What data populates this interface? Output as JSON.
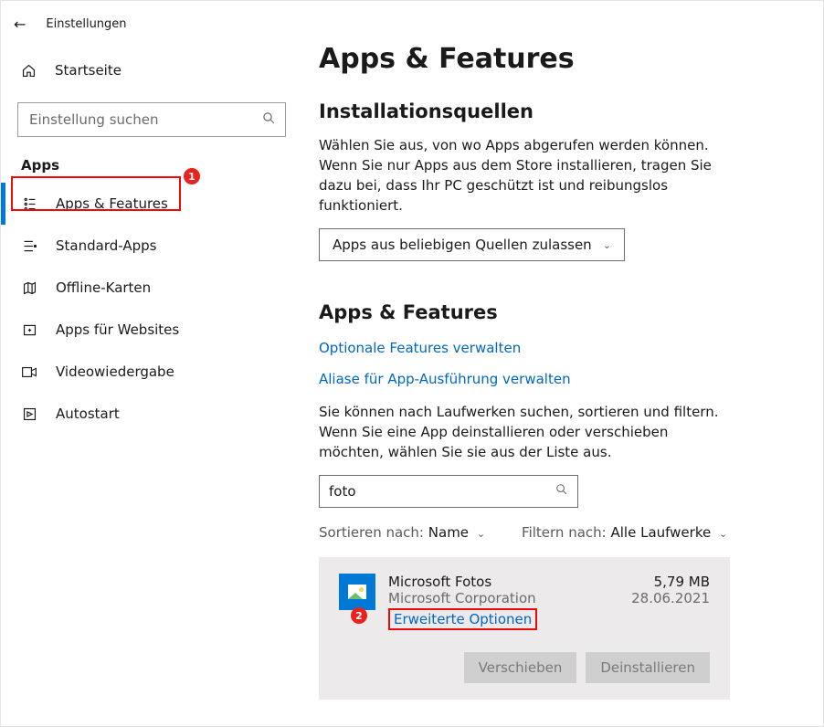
{
  "window": {
    "title": "Einstellungen"
  },
  "sidebar": {
    "home": "Startseite",
    "search_placeholder": "Einstellung suchen",
    "section": "Apps",
    "items": [
      {
        "label": "Apps & Features",
        "icon": "apps-features-icon",
        "selected": true
      },
      {
        "label": "Standard-Apps",
        "icon": "default-apps-icon"
      },
      {
        "label": "Offline-Karten",
        "icon": "offline-maps-icon"
      },
      {
        "label": "Apps für Websites",
        "icon": "apps-for-websites-icon"
      },
      {
        "label": "Videowiedergabe",
        "icon": "video-playback-icon"
      },
      {
        "label": "Autostart",
        "icon": "startup-icon"
      }
    ]
  },
  "main": {
    "title": "Apps & Features",
    "sources": {
      "heading": "Installationsquellen",
      "desc": "Wählen Sie aus, von wo Apps abgerufen werden können. Wenn Sie nur Apps aus dem Store installieren, tragen Sie dazu bei, dass Ihr PC geschützt ist und reibungslos funktioniert.",
      "dropdown": "Apps aus beliebigen Quellen zulassen"
    },
    "list": {
      "heading": "Apps & Features",
      "link_optional": "Optionale Features verwalten",
      "link_aliases": "Aliase für App-Ausführung verwalten",
      "desc": "Sie können nach Laufwerken suchen, sortieren und filtern. Wenn Sie eine App deinstallieren oder verschieben möchten, wählen Sie sie aus der Liste aus.",
      "search_value": "foto",
      "sort_label": "Sortieren nach:",
      "sort_value": "Name",
      "filter_label": "Filtern nach:",
      "filter_value": "Alle Laufwerke"
    },
    "app": {
      "name": "Microsoft Fotos",
      "publisher": "Microsoft Corporation",
      "advanced": "Erweiterte Optionen",
      "size": "5,79 MB",
      "date": "28.06.2021",
      "btn_move": "Verschieben",
      "btn_uninstall": "Deinstallieren"
    }
  },
  "annotations": {
    "one": "1",
    "two": "2"
  }
}
